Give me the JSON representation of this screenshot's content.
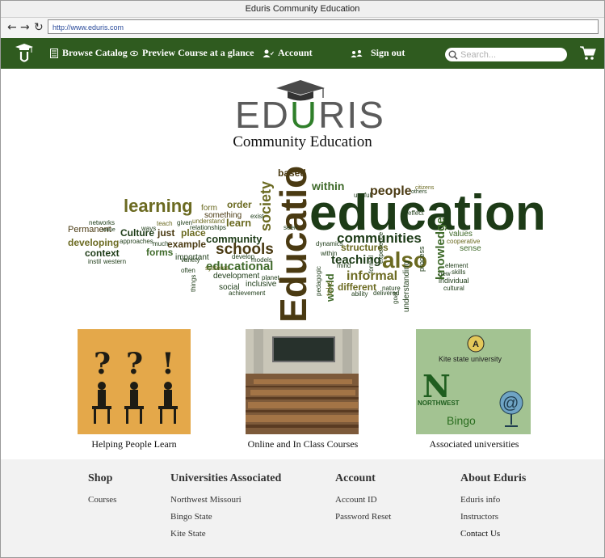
{
  "window": {
    "title": "Eduris Community Education"
  },
  "browser": {
    "url": "http://www.eduris.com"
  },
  "navbar": {
    "browse_catalog": "Browse Catalog",
    "preview_course": "Preview Course at a glance",
    "account": "Account",
    "sign_out": "Sign out",
    "search_placeholder": "Search..."
  },
  "brand": {
    "wordmark_left": "ED",
    "wordmark_u": "U",
    "wordmark_right": "RIS",
    "subtitle": "Community Education",
    "accent_color": "#2f7f2a",
    "nav_color": "#2f5b1f"
  },
  "cards": [
    {
      "label": "Helping People Learn"
    },
    {
      "label": "Online and In Class Courses"
    },
    {
      "label": "Associated universities"
    }
  ],
  "card_university_text": {
    "kite": "Kite state university",
    "northwest": "NORTHWEST",
    "bingo": "Bingo"
  },
  "footer": {
    "shop": {
      "title": "Shop",
      "links": [
        "Courses"
      ]
    },
    "universities": {
      "title": "Universities Associated",
      "links": [
        "Northwest Missouri",
        "Bingo State",
        "Kite State"
      ]
    },
    "account": {
      "title": "Account",
      "links": [
        "Account ID",
        "Password Reset"
      ]
    },
    "about": {
      "title": "About Eduris",
      "links": [
        "Eduris info",
        "Instructors",
        "Contact Us"
      ]
    }
  },
  "wordcloud": {
    "big": "education",
    "vertical": "Education",
    "words": [
      "learning",
      "schools",
      "communities",
      "also",
      "community",
      "educational",
      "teaching",
      "informal",
      "people",
      "within",
      "society",
      "knowledge",
      "Permanent",
      "Culture",
      "just",
      "place",
      "developing",
      "example",
      "context",
      "forms",
      "different",
      "structures",
      "order",
      "based",
      "learn",
      "form",
      "something",
      "development",
      "social",
      "inclusive",
      "values",
      "sense",
      "understanding",
      "process",
      "individual",
      "cultural",
      "world",
      "take",
      "important",
      "achievement",
      "useful",
      "effect",
      "others",
      "nature",
      "delivered",
      "ability",
      "mind",
      "planet",
      "models",
      "develop",
      "systems",
      "ways",
      "teach",
      "given",
      "relationships",
      "understand",
      "networks",
      "value",
      "approaches",
      "much",
      "variety",
      "western",
      "instil",
      "often",
      "things",
      "element",
      "skills",
      "new",
      "seen",
      "dynamics",
      "cooperative",
      "within",
      "citizens",
      "formal",
      "pedagogic",
      "experience",
      "exist",
      "goal",
      "well"
    ]
  }
}
